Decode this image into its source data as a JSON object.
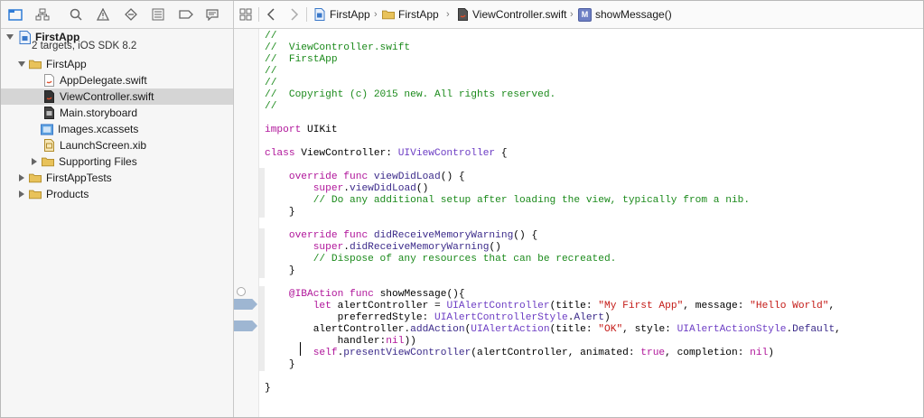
{
  "navigator": {
    "project": {
      "name": "FirstApp",
      "subtitle": "2 targets, iOS SDK 8.2"
    },
    "items": [
      {
        "label": "FirstApp",
        "icon": "folder-icon"
      },
      {
        "label": "AppDelegate.swift",
        "icon": "swift-file-icon"
      },
      {
        "label": "ViewController.swift",
        "icon": "swift-file-icon",
        "selected": true
      },
      {
        "label": "Main.storyboard",
        "icon": "storyboard-icon"
      },
      {
        "label": "Images.xcassets",
        "icon": "asset-catalog-icon"
      },
      {
        "label": "LaunchScreen.xib",
        "icon": "xib-icon"
      },
      {
        "label": "Supporting Files",
        "icon": "folder-icon"
      },
      {
        "label": "FirstAppTests",
        "icon": "folder-icon"
      },
      {
        "label": "Products",
        "icon": "folder-icon"
      }
    ],
    "toolbar_icons": [
      "project-navigator-icon",
      "symbol-navigator-icon",
      "find-navigator-icon",
      "issue-navigator-icon",
      "test-navigator-icon",
      "debug-navigator-icon",
      "breakpoint-navigator-icon",
      "report-navigator-icon"
    ]
  },
  "jumpbar": {
    "crumbs": [
      "FirstApp",
      "FirstApp",
      "ViewController.swift",
      "showMessage()"
    ],
    "method_badge": "M"
  },
  "code": {
    "lines": [
      "//",
      "//  ViewController.swift",
      "//  FirstApp",
      "//",
      "//",
      "//  Copyright (c) 2015 new. All rights reserved.",
      "//",
      "",
      "import UIKit",
      "",
      "class ViewController: UIViewController {",
      "",
      "    override func viewDidLoad() {",
      "        super.viewDidLoad()",
      "        // Do any additional setup after loading the view, typically from a nib.",
      "    }",
      "",
      "    override func didReceiveMemoryWarning() {",
      "        super.didReceiveMemoryWarning()",
      "        // Dispose of any resources that can be recreated.",
      "    }",
      "",
      "    @IBAction func showMessage(){",
      "        let alertController = UIAlertController(title: \"My First App\", message: \"Hello World\",",
      "            preferredStyle: UIAlertControllerStyle.Alert)",
      "        alertController.addAction(UIAlertAction(title: \"OK\", style: UIAlertActionStyle.Default,",
      "            handler:nil))",
      "        self.presentViewController(alertController, animated: true, completion: nil)",
      "    }",
      "",
      "}"
    ]
  },
  "colors": {
    "comment": "#1b8a1b",
    "keyword": "#b0159a",
    "type": "#6d3ec4",
    "string": "#c41a16",
    "selection": "#d5d5d5",
    "breakpoint": "#9eb6d2"
  }
}
